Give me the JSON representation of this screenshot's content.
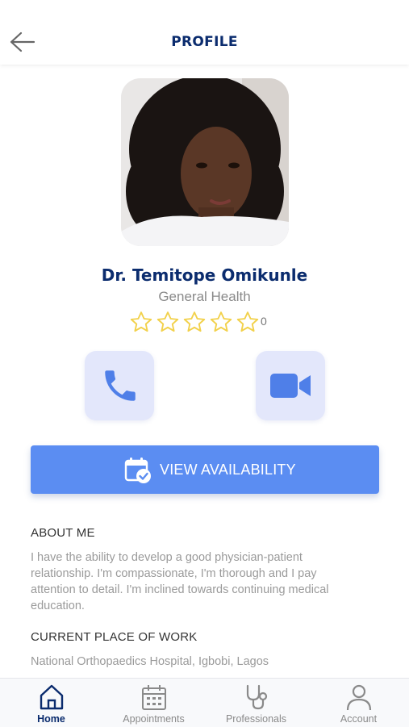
{
  "header": {
    "title": "PROFILE",
    "back_icon": "arrow-left-icon"
  },
  "doctor": {
    "name": "Dr. Temitope Omikunle",
    "specialty": "General Health",
    "rating_count": "0",
    "stars_total": 5,
    "stars_filled": 0
  },
  "actions": {
    "call_icon": "phone-icon",
    "video_icon": "video-camera-icon"
  },
  "availability_button": {
    "label": "VIEW AVAILABILITY",
    "icon": "calendar-check-icon"
  },
  "about": {
    "title": "ABOUT ME",
    "lines": [
      "I have the ability to develop a good physician-patient",
      "relationship. I'm compassionate, I'm thorough and I pay",
      "attention to detail. I'm inclined towards continuing medical",
      "education."
    ]
  },
  "work": {
    "title": "CURRENT PLACE OF WORK",
    "value": "National Orthopaedics Hospital, Igbobi, Lagos"
  },
  "tabs": [
    {
      "label": "Home",
      "icon": "home-icon",
      "active": true
    },
    {
      "label": "Appointments",
      "icon": "calendar-icon",
      "active": false
    },
    {
      "label": "Professionals",
      "icon": "stethoscope-icon",
      "active": false
    },
    {
      "label": "Account",
      "icon": "user-icon",
      "active": false
    }
  ],
  "colors": {
    "primary": "#5b8df2",
    "navy": "#0b2c6e",
    "action_bg": "#e3e7fb",
    "star": "#f2d14b"
  }
}
